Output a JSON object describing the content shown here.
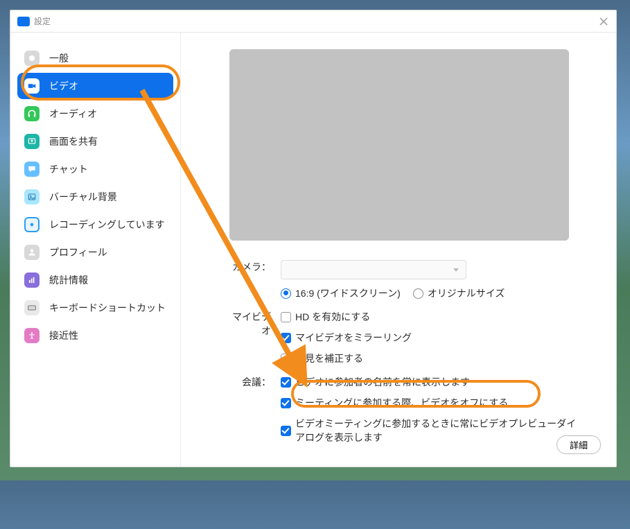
{
  "window": {
    "title": "設定"
  },
  "sidebar": {
    "items": [
      {
        "label": "一般"
      },
      {
        "label": "ビデオ"
      },
      {
        "label": "オーディオ"
      },
      {
        "label": "画面を共有"
      },
      {
        "label": "チャット"
      },
      {
        "label": "バーチャル背景"
      },
      {
        "label": "レコーディングしています"
      },
      {
        "label": "プロフィール"
      },
      {
        "label": "統計情報"
      },
      {
        "label": "キーボードショートカット"
      },
      {
        "label": "接近性"
      }
    ]
  },
  "video": {
    "camera_label": "カメラ：",
    "aspect": {
      "wide": "16:9 (ワイドスクリーン)",
      "original": "オリジナルサイズ",
      "selected": "wide"
    },
    "myvideo_label": "マイビデオ",
    "opts": {
      "hd": {
        "label": "HD を有効にする",
        "checked": false
      },
      "mirror": {
        "label": "マイビデオをミラーリング",
        "checked": true
      },
      "touchup": {
        "label": "外見を補正する",
        "checked": false
      }
    },
    "meeting_label": "会議：",
    "meeting": {
      "show_names": {
        "label": "ビデオに参加者の名前を常に表示します",
        "checked": true
      },
      "video_off_on_join": {
        "label": "ミーティングに参加する際、ビデオをオフにする",
        "checked": true
      },
      "preview_dialog": {
        "label": "ビデオミーティングに参加するときに常にビデオプレビューダイアログを表示します",
        "checked": true
      }
    },
    "detail_button": "詳細"
  }
}
